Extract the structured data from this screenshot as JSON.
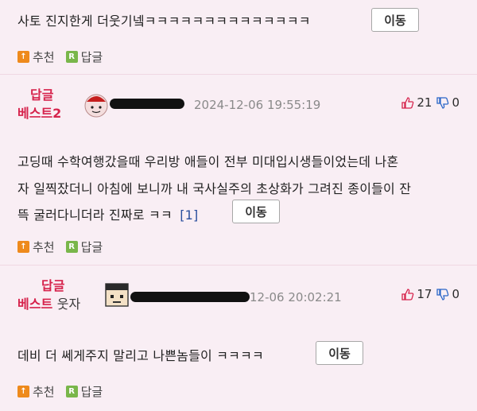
{
  "comment0": {
    "text": "사토 진지한게 더웃기넼ㅋㅋㅋㅋㅋㅋㅋㅋㅋㅋㅋㅋㅋㅋ",
    "move_label": "이동",
    "recommend_label": "추천",
    "reply_label": "답글"
  },
  "best2": {
    "badge_line1": "답글",
    "badge_line2": "베스트2",
    "date": "2024-12-06 19:55:19",
    "likes": "21",
    "dislikes": "0",
    "text_lines": [
      "고딩때 수학여행갔을때 우리방 애들이 전부 미대입시생들이었는데 나혼",
      "자 일찍잤더니 아침에 보니까 내 국사실주의 초상화가 그려진 종이들이 잔",
      "뜩 굴러다니더라 진짜로 ㅋㅋ"
    ],
    "reply_count": "[1]",
    "move_label": "이동",
    "recommend_label": "추천",
    "reply_label": "답글"
  },
  "best3": {
    "badge_line1": "답글",
    "badge_line2a": "베스트",
    "badge_line2b": "웃자",
    "date": "12-06 20:02:21",
    "likes": "17",
    "dislikes": "0",
    "text": "데비 더 쎄게주지 말리고 나쁜놈들이 ㅋㅋㅋㅋ",
    "move_label": "이동",
    "recommend_label": "추천",
    "reply_label": "답글"
  },
  "icons": {
    "recommend": "recommend-icon",
    "reply": "reply-icon",
    "thumbs_up": "thumbs-up-icon",
    "thumbs_down": "thumbs-down-icon"
  },
  "colors": {
    "best_label": "#d6234c",
    "recommend_badge": "#ee8a1c",
    "reply_badge": "#79b64a",
    "background": "#f9eef4"
  }
}
